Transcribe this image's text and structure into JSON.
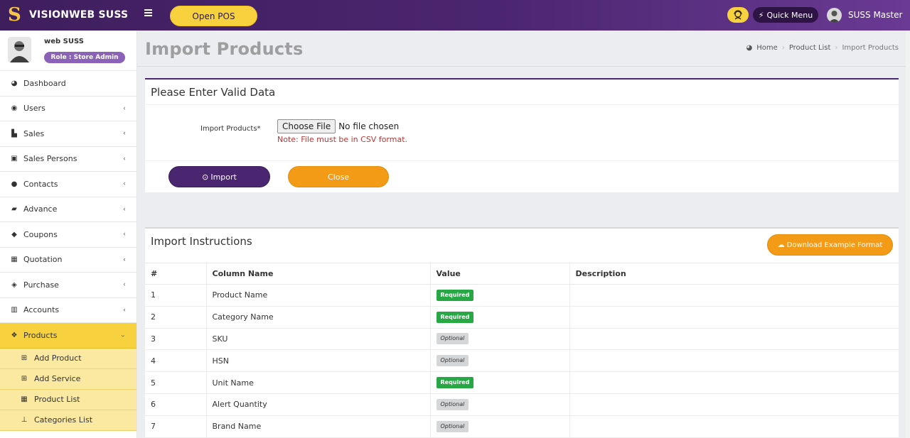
{
  "app": {
    "brand_letter": "S",
    "brand_name": "VISIONWEB SUSS",
    "open_pos": "Open POS",
    "quick_menu": "Quick Menu",
    "user_name": "SUSS Master"
  },
  "profile": {
    "name": "web SUSS",
    "role": "Role : Store Admin"
  },
  "sidebar": {
    "items": [
      {
        "label": "Dashboard",
        "icon": "dashboard-icon",
        "glyph": "◕",
        "chevron": false
      },
      {
        "label": "Users",
        "icon": "user-circle-icon",
        "glyph": "◉",
        "chevron": true
      },
      {
        "label": "Sales",
        "icon": "cart-icon",
        "glyph": "▙",
        "chevron": true
      },
      {
        "label": "Sales Persons",
        "icon": "id-card-icon",
        "glyph": "▣",
        "chevron": true
      },
      {
        "label": "Contacts",
        "icon": "users-icon",
        "glyph": "●",
        "chevron": true
      },
      {
        "label": "Advance",
        "icon": "book-icon",
        "glyph": "▰",
        "chevron": true
      },
      {
        "label": "Coupons",
        "icon": "tag-icon",
        "glyph": "◆",
        "chevron": true
      },
      {
        "label": "Quotation",
        "icon": "calendar-icon",
        "glyph": "▦",
        "chevron": true
      },
      {
        "label": "Purchase",
        "icon": "box-icon",
        "glyph": "◈",
        "chevron": true
      },
      {
        "label": "Accounts",
        "icon": "bank-icon",
        "glyph": "▥",
        "chevron": true
      }
    ],
    "active": {
      "label": "Products",
      "icon": "cubes-icon",
      "glyph": "❖"
    },
    "sub_items": [
      {
        "label": "Add Product",
        "icon": "plus-square-icon",
        "glyph": "⊞"
      },
      {
        "label": "Add Service",
        "icon": "plus-square-icon",
        "glyph": "⊞"
      },
      {
        "label": "Product List",
        "icon": "grid-icon",
        "glyph": "▦"
      },
      {
        "label": "Categories List",
        "icon": "sitemap-icon",
        "glyph": "⊥"
      }
    ]
  },
  "page": {
    "title": "Import Products",
    "breadcrumb": [
      "Home",
      "Product List",
      "Import Products"
    ]
  },
  "form": {
    "title": "Please Enter Valid Data",
    "field_label": "Import Products*",
    "choose_file": "Choose File",
    "no_file": "No file chosen",
    "note": "Note: File must be in CSV format.",
    "import_label": "Import",
    "close_label": "Close"
  },
  "instructions": {
    "title": "Import Instructions",
    "download_label": "Download Example Format",
    "headers": [
      "#",
      "Column Name",
      "Value",
      "Description"
    ],
    "rows": [
      {
        "num": "1",
        "name": "Product Name",
        "value": "Required",
        "desc": ""
      },
      {
        "num": "2",
        "name": "Category Name",
        "value": "Required",
        "desc": ""
      },
      {
        "num": "3",
        "name": "SKU",
        "value": "Optional",
        "desc": ""
      },
      {
        "num": "4",
        "name": "HSN",
        "value": "Optional",
        "desc": ""
      },
      {
        "num": "5",
        "name": "Unit Name",
        "value": "Required",
        "desc": ""
      },
      {
        "num": "6",
        "name": "Alert Quantity",
        "value": "Optional",
        "desc": ""
      },
      {
        "num": "7",
        "name": "Brand Name",
        "value": "Optional",
        "desc": ""
      }
    ]
  },
  "colors": {
    "primary": "#4b2670",
    "accent_yellow": "#f7d23e",
    "accent_orange": "#f39b17",
    "required_green": "#28a745"
  }
}
